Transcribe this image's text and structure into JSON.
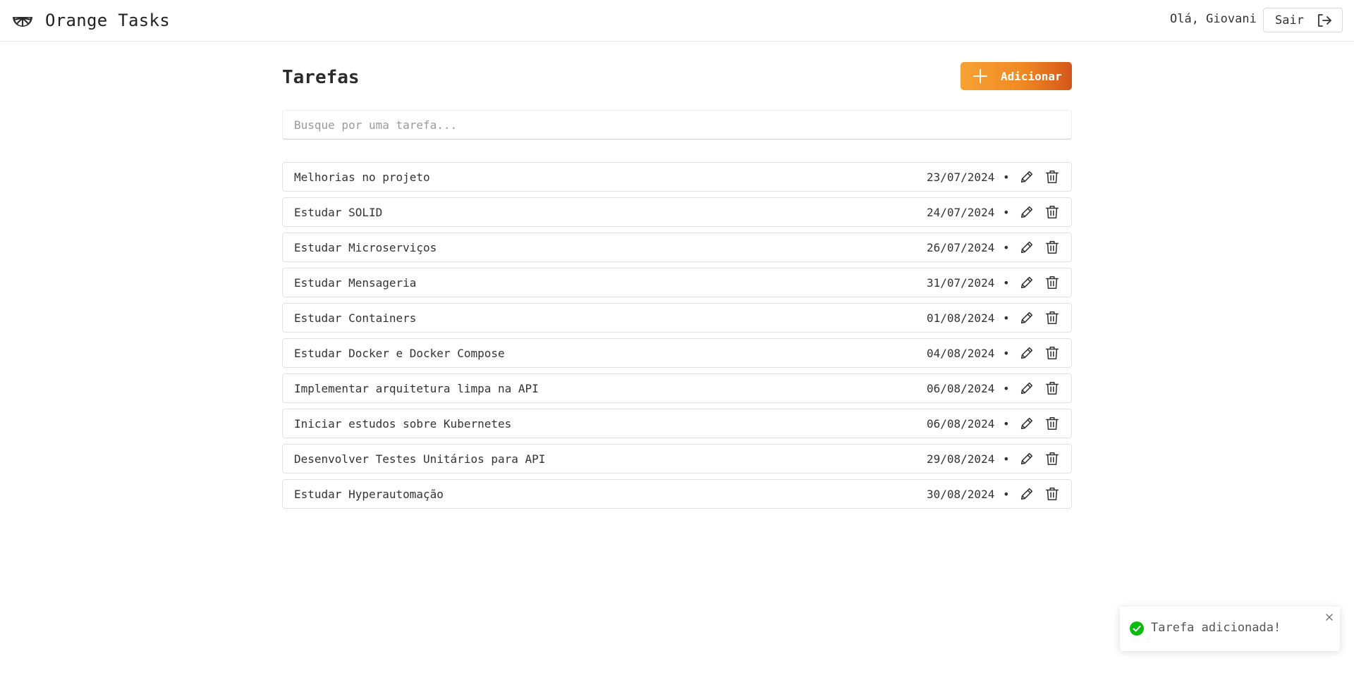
{
  "app": {
    "name": "Orange Tasks",
    "logo_icon": "orange-slice-icon",
    "accent_color": "#f08a23"
  },
  "header": {
    "greeting": "Olá, Giovani",
    "logout_label": "Sair",
    "logout_icon": "logout-icon"
  },
  "main": {
    "title": "Tarefas",
    "add_button_label": "Adicionar",
    "add_button_icon": "plus-icon"
  },
  "search": {
    "placeholder": "Busque por uma tarefa...",
    "value": ""
  },
  "tasks": [
    {
      "title": "Melhorias no projeto",
      "date": "23/07/2024",
      "separator": "•"
    },
    {
      "title": "Estudar SOLID",
      "date": "24/07/2024",
      "separator": "•"
    },
    {
      "title": "Estudar Microserviços",
      "date": "26/07/2024",
      "separator": "•"
    },
    {
      "title": "Estudar Mensageria",
      "date": "31/07/2024",
      "separator": "•"
    },
    {
      "title": "Estudar Containers",
      "date": "01/08/2024",
      "separator": "•"
    },
    {
      "title": "Estudar Docker e Docker Compose",
      "date": "04/08/2024",
      "separator": "•"
    },
    {
      "title": "Implementar arquitetura limpa na API",
      "date": "06/08/2024",
      "separator": "•"
    },
    {
      "title": "Iniciar estudos sobre Kubernetes",
      "date": "06/08/2024",
      "separator": "•"
    },
    {
      "title": "Desenvolver Testes Unitários para API",
      "date": "29/08/2024",
      "separator": "•"
    },
    {
      "title": "Estudar Hyperautomação",
      "date": "30/08/2024",
      "separator": "•"
    }
  ],
  "toast": {
    "message": "Tarefa adicionada!",
    "status_color": "#07bc0c",
    "icon": "check-circle-icon"
  }
}
